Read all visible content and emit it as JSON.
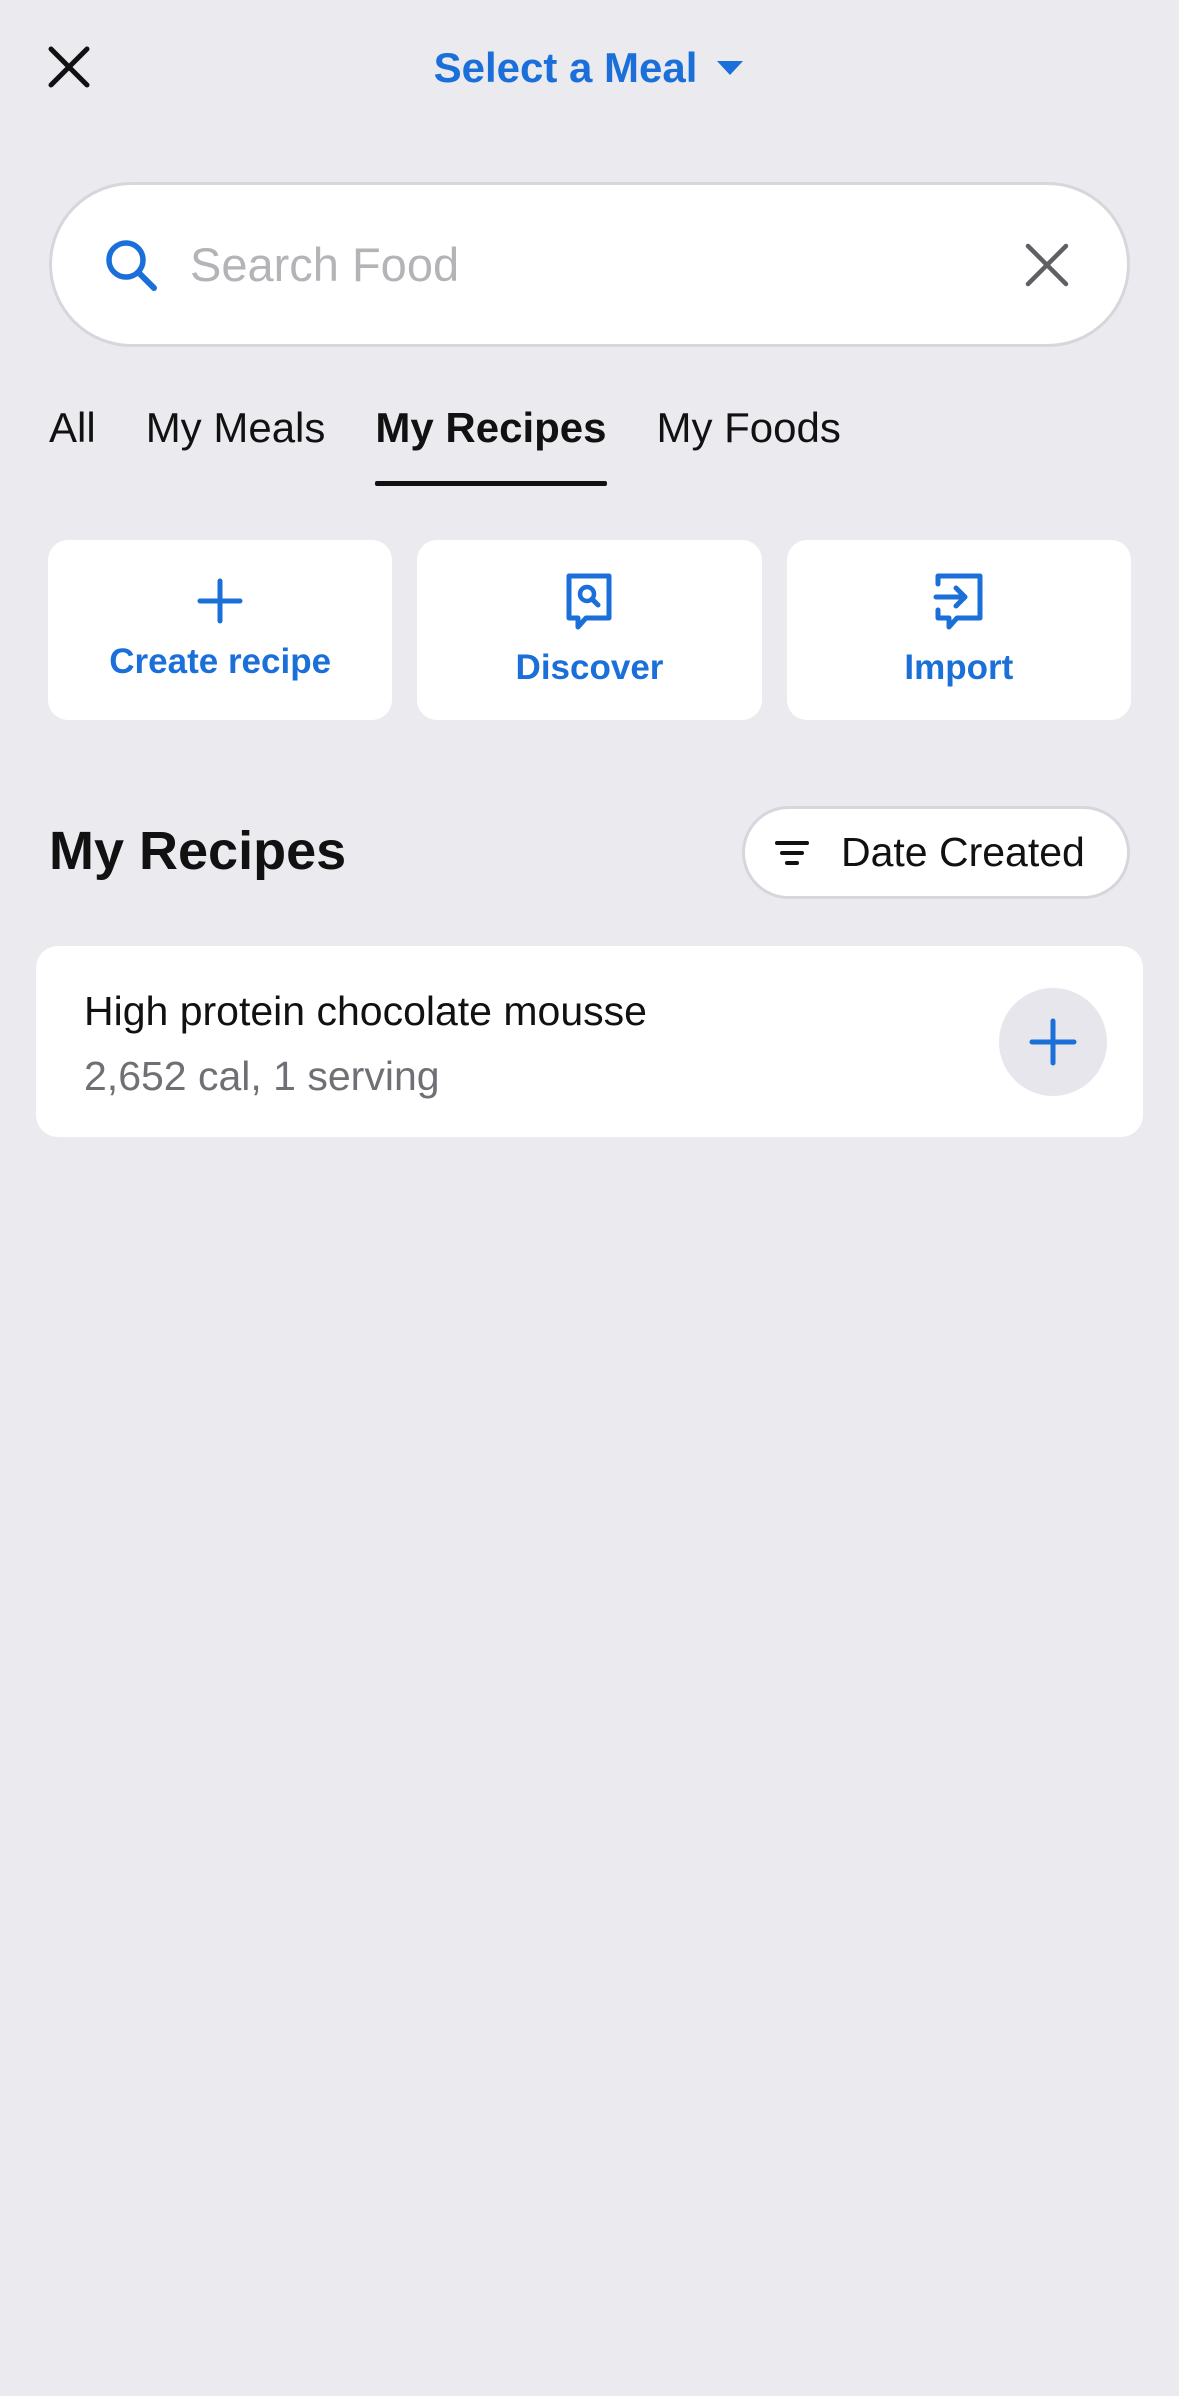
{
  "header": {
    "meal_select_label": "Select a Meal"
  },
  "search": {
    "placeholder": "Search Food",
    "value": ""
  },
  "tabs": [
    {
      "label": "All",
      "active": false
    },
    {
      "label": "My Meals",
      "active": false
    },
    {
      "label": "My Recipes",
      "active": true
    },
    {
      "label": "My Foods",
      "active": false
    }
  ],
  "actions": {
    "create_label": "Create recipe",
    "discover_label": "Discover",
    "import_label": "Import"
  },
  "section": {
    "title": "My Recipes",
    "sort_label": "Date Created"
  },
  "recipes": [
    {
      "name": "High protein chocolate mousse",
      "meta": "2,652 cal, 1 serving"
    }
  ],
  "colors": {
    "accent": "#1a6fd9",
    "background": "#eaeaef",
    "card": "#ffffff"
  },
  "icons": {
    "close": "close-icon",
    "dropdown": "caret-down-icon",
    "search": "search-icon",
    "clear": "clear-icon",
    "create": "plus-icon",
    "discover": "recipe-search-icon",
    "import": "import-icon",
    "sort": "filter-lines-icon",
    "add": "plus-icon"
  }
}
